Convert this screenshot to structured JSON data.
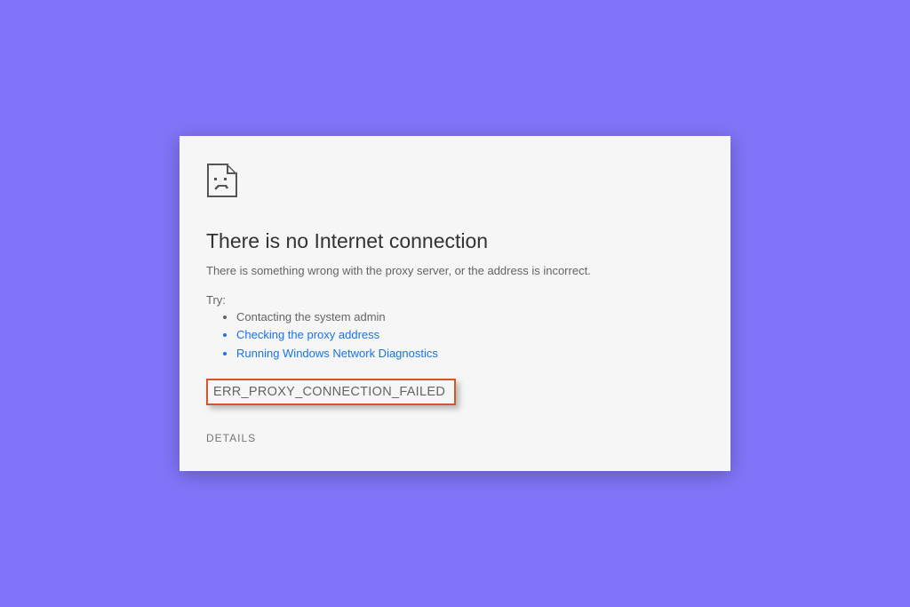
{
  "error": {
    "heading": "There is no Internet connection",
    "subheading": "There is something wrong with the proxy server, or the address is incorrect.",
    "try_label": "Try:",
    "suggestions": {
      "item0": "Contacting the system admin",
      "item1": "Checking the proxy address",
      "item2": "Running Windows Network Diagnostics"
    },
    "code": "ERR_PROXY_CONNECTION_FAILED",
    "details_button": "DETAILS"
  }
}
